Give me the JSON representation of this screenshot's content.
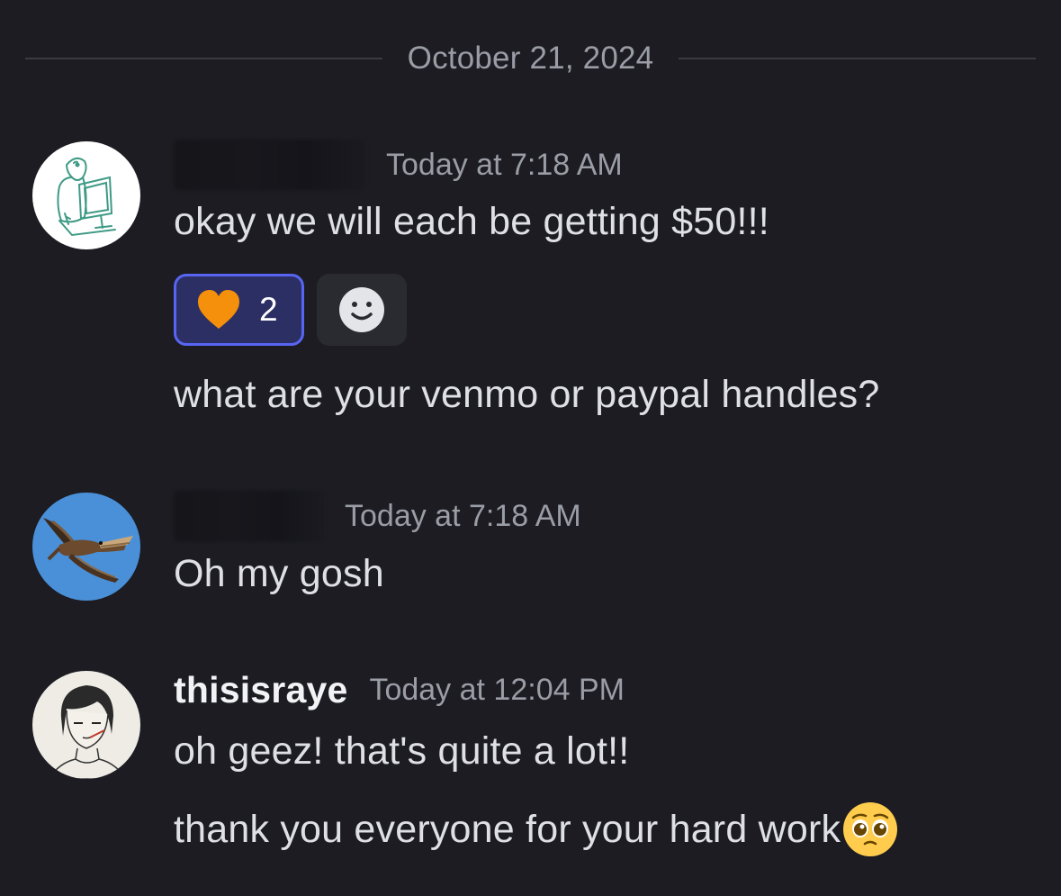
{
  "date_divider": "October 21, 2024",
  "messages": [
    {
      "username": "",
      "timestamp": "Today at 7:18 AM",
      "lines": [
        "okay we will each be getting $50!!!",
        "what are your venmo or paypal handles?"
      ],
      "reactions": [
        {
          "emoji_icon": "orange-heart-icon",
          "count": "2"
        }
      ],
      "add_reaction_icon": "add-reaction-smiley-icon"
    },
    {
      "username": "",
      "timestamp": "Today at 7:18 AM",
      "lines": [
        "Oh my gosh"
      ]
    },
    {
      "username": "thisisraye",
      "timestamp": "Today at 12:04 PM",
      "lines": [
        "oh geez! that's quite a lot!!",
        "thank you everyone for your hard work"
      ],
      "trailing_emoji_icon": "pleading-face-icon"
    }
  ],
  "colors": {
    "background": "#1c1c22",
    "reaction_active_bg": "#2c2f63",
    "reaction_active_border": "#5865f2",
    "heart": "#f4900c"
  }
}
